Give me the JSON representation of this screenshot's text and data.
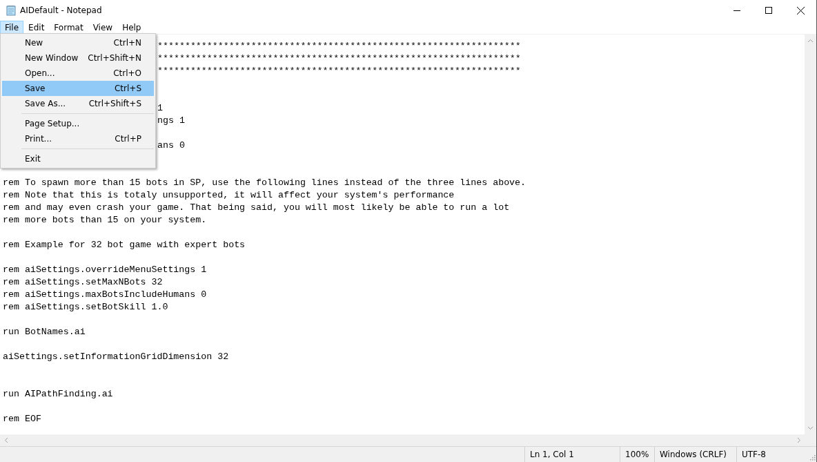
{
  "window": {
    "title": "AIDefault - Notepad"
  },
  "menu_bar": [
    {
      "label": "File",
      "selected": true
    },
    {
      "label": "Edit",
      "selected": false
    },
    {
      "label": "Format",
      "selected": false
    },
    {
      "label": "View",
      "selected": false
    },
    {
      "label": "Help",
      "selected": false
    }
  ],
  "file_menu": [
    {
      "kind": "item",
      "label": "New",
      "shortcut": "Ctrl+N",
      "selected": false
    },
    {
      "kind": "item",
      "label": "New Window",
      "shortcut": "Ctrl+Shift+N",
      "selected": false
    },
    {
      "kind": "item",
      "label": "Open...",
      "shortcut": "Ctrl+O",
      "selected": false
    },
    {
      "kind": "item",
      "label": "Save",
      "shortcut": "Ctrl+S",
      "selected": true
    },
    {
      "kind": "item",
      "label": "Save As...",
      "shortcut": "Ctrl+Shift+S",
      "selected": false
    },
    {
      "kind": "separator"
    },
    {
      "kind": "item",
      "label": "Page Setup...",
      "selected": false
    },
    {
      "kind": "item",
      "label": "Print...",
      "shortcut": "Ctrl+P",
      "selected": false
    },
    {
      "kind": "separator"
    },
    {
      "kind": "item",
      "label": "Exit",
      "selected": false
    }
  ],
  "editor_lines": [
    {
      "kind": "partial",
      "text": "******************************************************************"
    },
    {
      "kind": "partial",
      "text": "******************************************************************"
    },
    {
      "kind": "partial",
      "text": "******************************************************************"
    },
    {
      "kind": "blank"
    },
    {
      "kind": "blank"
    },
    {
      "kind": "partial",
      "text": "1"
    },
    {
      "kind": "partial",
      "text": "ngs 1"
    },
    {
      "kind": "blank"
    },
    {
      "kind": "partial",
      "text": "ans 0"
    },
    {
      "kind": "blank"
    },
    {
      "kind": "blank"
    },
    {
      "kind": "full",
      "text": "rem To spawn more than 15 bots in SP, use the following lines instead of the three lines above."
    },
    {
      "kind": "full",
      "text": "rem Note that this is totaly unsupported, it will affect your system's performance"
    },
    {
      "kind": "full",
      "text": "rem and may even crash your game. That being said, you will most likely be able to run a lot"
    },
    {
      "kind": "full",
      "text": "rem more bots than 15 on your system."
    },
    {
      "kind": "blank"
    },
    {
      "kind": "full",
      "text": "rem Example for 32 bot game with expert bots"
    },
    {
      "kind": "blank"
    },
    {
      "kind": "full",
      "text": "rem aiSettings.overrideMenuSettings 1"
    },
    {
      "kind": "full",
      "text": "rem aiSettings.setMaxNBots 32"
    },
    {
      "kind": "full",
      "text": "rem aiSettings.maxBotsIncludeHumans 0"
    },
    {
      "kind": "full",
      "text": "rem aiSettings.setBotSkill 1.0"
    },
    {
      "kind": "blank"
    },
    {
      "kind": "full",
      "text": "run BotNames.ai"
    },
    {
      "kind": "blank"
    },
    {
      "kind": "full",
      "text": "aiSettings.setInformationGridDimension 32"
    },
    {
      "kind": "blank"
    },
    {
      "kind": "blank"
    },
    {
      "kind": "full",
      "text": "run AIPathFinding.ai"
    },
    {
      "kind": "blank"
    },
    {
      "kind": "full",
      "text": "rem EOF"
    }
  ],
  "status_bar": [
    {
      "kind": "position",
      "text": "Ln 1, Col 1"
    },
    {
      "kind": "zoom",
      "text": "100%"
    },
    {
      "kind": "line_ending",
      "text": "Windows (CRLF)"
    },
    {
      "kind": "encoding",
      "text": "UTF-8"
    }
  ]
}
